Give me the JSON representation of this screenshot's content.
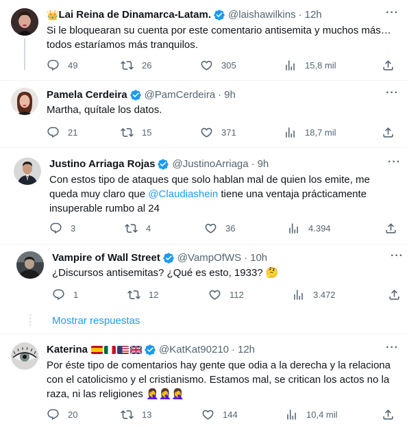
{
  "tweets": [
    {
      "name": "Lai Reina de Dinamarca-Latam.",
      "name_prefix": "👑",
      "handle": "@laishawilkins",
      "time": "12h",
      "text": "Si le bloquearan su cuenta por este comentario antisemita y muchos más… todos estaríamos más tranquilos.",
      "replies": "49",
      "retweets": "26",
      "likes": "305",
      "views": "15,8 mil"
    },
    {
      "name": "Pamela Cerdeira",
      "handle": "@PamCerdeira",
      "time": "9h",
      "text": "Martha, quítale los datos.",
      "replies": "21",
      "retweets": "15",
      "likes": "371",
      "views": "18,7 mil"
    },
    {
      "name": "Justino Arriaga Rojas",
      "handle": "@JustinoArriaga",
      "time": "9h",
      "text_before": "Con estos tipo de ataques que solo hablan mal de quien los emite, me queda muy claro que ",
      "mention": "@Claudiashein",
      "text_after": " tiene una ventaja prácticamente insuperable rumbo al 24",
      "replies": "3",
      "retweets": "4",
      "likes": "36",
      "views": "4.394"
    },
    {
      "name": "Vampire of Wall Street",
      "handle": "@VampOfWS",
      "time": "10h",
      "text": "¿Discursos antisemitas? ¿Qué es esto, 1933? 🤔",
      "replies": "1",
      "retweets": "12",
      "likes": "112",
      "views": "3.472"
    },
    {
      "name": "Katerina",
      "handle": "@KatKat90210",
      "time": "12h",
      "text": "Por éste tipo de comentarios hay gente que odia a la derecha y la relaciona con el catolicismo y el cristianismo. Estamos mal, se critican los actos no la raza, ni las religiones 🤦‍♀️🤦‍♀️🤦‍♀️",
      "replies": "20",
      "retweets": "13",
      "likes": "144",
      "views": "10,4 mil"
    }
  ],
  "show_replies_label": "Mostrar respuestas",
  "colors": {
    "accent": "#1d9bf0",
    "muted": "#536471",
    "separator": "#eff3f4"
  }
}
